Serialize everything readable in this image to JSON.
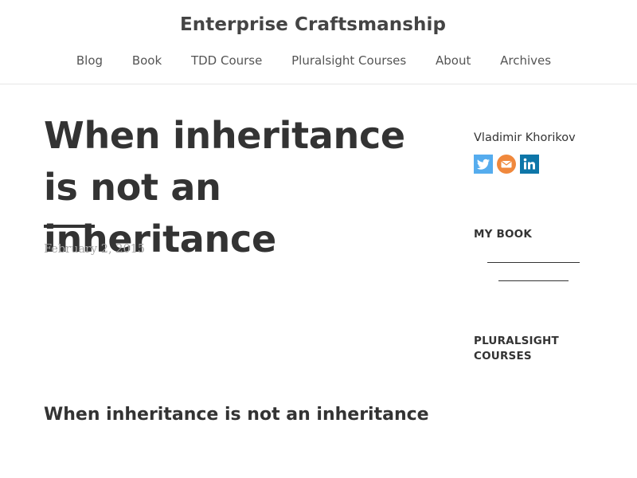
{
  "site": {
    "title": "Enterprise Craftsmanship"
  },
  "nav": {
    "items": [
      "Blog",
      "Book",
      "TDD Course",
      "Pluralsight Courses",
      "About",
      "Archives"
    ]
  },
  "post": {
    "title": "When inheritance is not an inheritance",
    "date": "February 2, 2015",
    "section_heading": "When inheritance is not an inheritance"
  },
  "sidebar": {
    "author": "Vladimir Khorikov",
    "social_icons": [
      "twitter-icon",
      "email-icon",
      "linkedin-icon"
    ],
    "my_book_title": "MY BOOK",
    "pluralsight_title": "PLURALSIGHT COURSES"
  },
  "colors": {
    "text": "#333333",
    "twitter": "#55acee",
    "email": "#f0883c",
    "linkedin": "#0e76a8",
    "date": "#a8a8a8"
  }
}
